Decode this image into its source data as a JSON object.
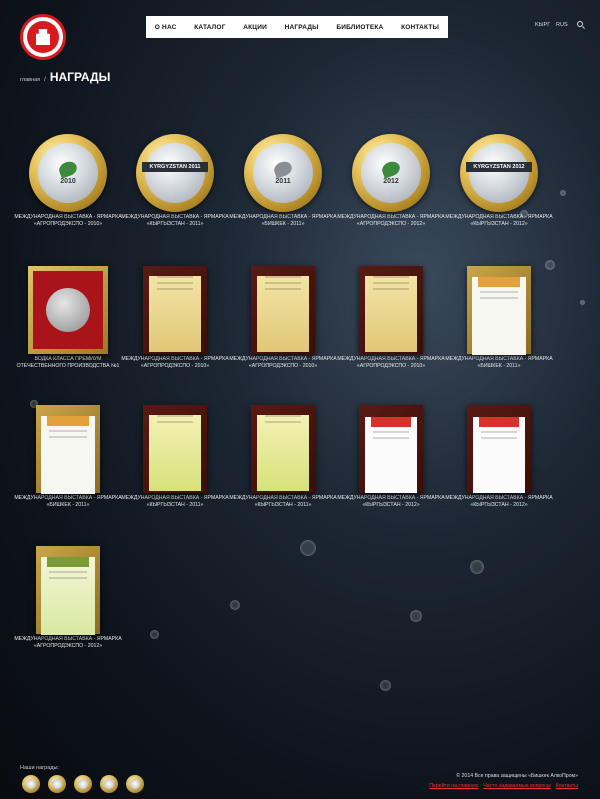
{
  "header": {
    "nav": [
      "О НАС",
      "КАТАЛОГ",
      "АКЦИИ",
      "НАГРАДЫ",
      "БИБЛИОТЕКА",
      "КОНТАКТЫ"
    ],
    "lang": [
      "KЫРГ",
      "RUS"
    ]
  },
  "breadcrumb": {
    "home": "главная",
    "sep": "/",
    "title": "НАГРАДЫ"
  },
  "awards": [
    {
      "caption": "МЕЖДУНАРОДНАЯ ВЫСТАВКА - ЯРМАРКА «АГРОПРОДЭКСПО - 2010»"
    },
    {
      "caption": "МЕЖДУНАРОДНАЯ ВЫСТАВКА - ЯРМАРКА «КЫРГЫЗСТАН - 2011»"
    },
    {
      "caption": "МЕЖДУНАРОДНАЯ ВЫСТАВКА - ЯРМАРКА «БИШКЕК - 2011»"
    },
    {
      "caption": "МЕЖДУНАРОДНАЯ ВЫСТАВКА - ЯРМАРКА «АГРОПРОДЭКСПО - 2012»"
    },
    {
      "caption": "МЕЖДУНАРОДНАЯ ВЫСТАВКА - ЯРМАРКА «КЫРГЫЗСТАН - 2012»"
    },
    {
      "caption": "ВОДКА КЛАССА ПРЕМИУМ ОТЕЧЕСТВЕННОГО ПРОИЗВОДСТВА №1"
    },
    {
      "caption": "МЕЖДУНАРОДНАЯ ВЫСТАВКА - ЯРМАРКА «АГРОПРОДЭКСПО - 2010»"
    },
    {
      "caption": "МЕЖДУНАРОДНАЯ ВЫСТАВКА - ЯРМАРКА «АГРОПРОДЭКСПО - 2010»"
    },
    {
      "caption": "МЕЖДУНАРОДНАЯ ВЫСТАВКА - ЯРМАРКА «АГРОПРОДЭКСПО - 2010»"
    },
    {
      "caption": "МЕЖДУНАРОДНАЯ ВЫСТАВКА - ЯРМАРКА «БИШКЕК - 2011»"
    },
    {
      "caption": "МЕЖДУНАРОДНАЯ ВЫСТАВКА - ЯРМАРКА «БИШКЕК - 2011»"
    },
    {
      "caption": "МЕЖДУНАРОДНАЯ ВЫСТАВКА - ЯРМАРКА «КЫРГЫЗСТАН - 2011»"
    },
    {
      "caption": "МЕЖДУНАРОДНАЯ ВЫСТАВКА - ЯРМАРКА «КЫРГЫЗСТАН - 2011»"
    },
    {
      "caption": "МЕЖДУНАРОДНАЯ ВЫСТАВКА - ЯРМАРКА «КЫРГЫЗСТАН - 2012»"
    },
    {
      "caption": "МЕЖДУНАРОДНАЯ ВЫСТАВКА - ЯРМАРКА «КЫРГЫЗСТАН - 2012»"
    },
    {
      "caption": "МЕЖДУНАРОДНАЯ ВЫСТАВКА - ЯРМАРКА «АГРОПРОДЭКСПО - 2012»"
    }
  ],
  "medal_labels": {
    "m1": "2010",
    "m2": "KYRGYZSTAN 2011",
    "m3": "2011",
    "m4": "2012",
    "m5": "KYRGYZSTAN 2012"
  },
  "footer": {
    "label": "Наши награды:",
    "copyright": "© 2014 Все права защищены «Бишкек АлкоПром»",
    "links": [
      "Перейти на главную",
      "Часто задаваемые вопросы",
      "Контакты"
    ]
  }
}
